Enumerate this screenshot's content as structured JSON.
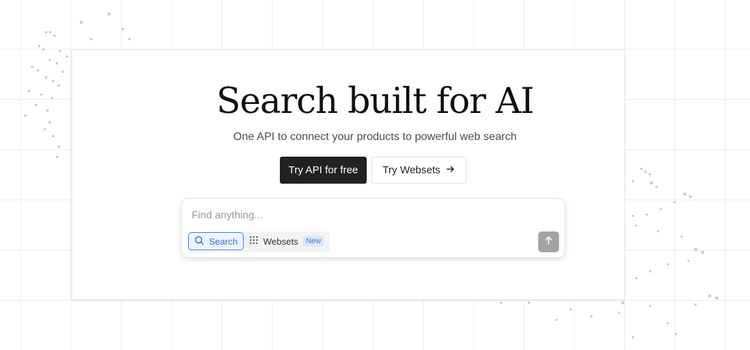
{
  "hero": {
    "title": "Search built for AI",
    "subtitle": "One API to connect your products to powerful web search"
  },
  "cta": {
    "primary_label": "Try API for free",
    "secondary_label": "Try Websets",
    "secondary_icon": "arrow-right-icon"
  },
  "search": {
    "placeholder": "Find anything...",
    "value": "",
    "modes": [
      {
        "label": "Search",
        "icon": "search-icon",
        "selected": true
      },
      {
        "label": "Websets",
        "icon": "grid-dots-icon",
        "badge": "New",
        "selected": false
      }
    ],
    "submit_icon": "arrow-up-icon"
  },
  "colors": {
    "primary_button": "#222222",
    "accent_blue": "#3b82f6",
    "badge_bg": "#dbe8fb",
    "submit_bg": "#a3a3a3"
  }
}
